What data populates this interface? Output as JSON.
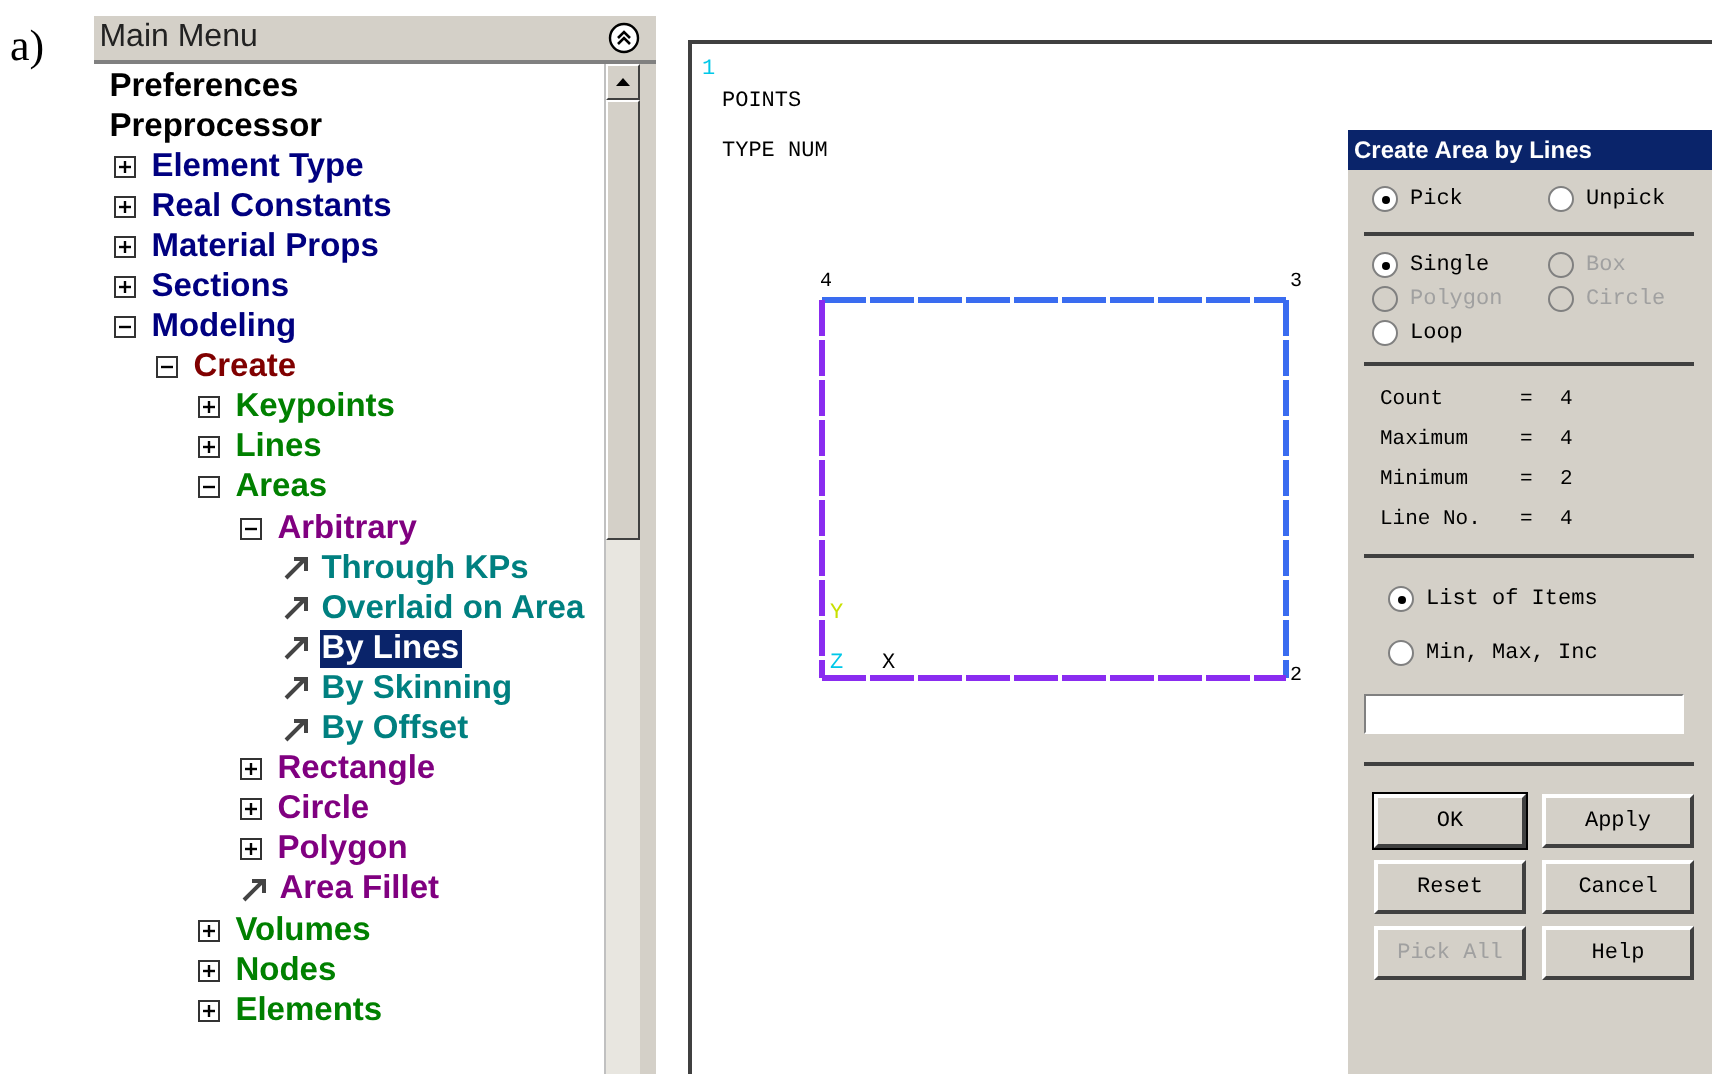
{
  "figure_label": "a)",
  "menu": {
    "title": "Main Menu",
    "items": [
      {
        "label": "Preferences",
        "selected": false,
        "color": "#000000"
      },
      {
        "label": "Preprocessor",
        "selected": false,
        "color": "#000000",
        "children": [
          {
            "label": "Element Type",
            "kind": "branch",
            "expanded": false,
            "selected": false,
            "color": "#000080"
          },
          {
            "label": "Real Constants",
            "kind": "branch",
            "expanded": false,
            "selected": false,
            "color": "#000080"
          },
          {
            "label": "Material Props",
            "kind": "branch",
            "expanded": false,
            "selected": false,
            "color": "#000080"
          },
          {
            "label": "Sections",
            "kind": "branch",
            "expanded": false,
            "selected": false,
            "color": "#000080"
          },
          {
            "label": "Modeling",
            "kind": "branch",
            "expanded": true,
            "selected": false,
            "color": "#000080",
            "children": [
              {
                "label": "Create",
                "kind": "branch",
                "expanded": true,
                "selected": false,
                "color": "#800000",
                "children": [
                  {
                    "label": "Keypoints",
                    "kind": "branch",
                    "expanded": false,
                    "selected": false,
                    "color": "#008000"
                  },
                  {
                    "label": "Lines",
                    "kind": "branch",
                    "expanded": false,
                    "selected": false,
                    "color": "#008000"
                  },
                  {
                    "label": "Areas",
                    "kind": "branch",
                    "expanded": true,
                    "selected": false,
                    "color": "#008000",
                    "children": [
                      {
                        "label": "Arbitrary",
                        "kind": "branch",
                        "expanded": true,
                        "selected": false,
                        "color": "#800080",
                        "children": [
                          {
                            "label": "Through KPs",
                            "kind": "action",
                            "selected": false,
                            "color": "#008080"
                          },
                          {
                            "label": "Overlaid on Area",
                            "kind": "action",
                            "selected": false,
                            "color": "#008080"
                          },
                          {
                            "label": "By Lines",
                            "kind": "action",
                            "selected": true
                          },
                          {
                            "label": "By Skinning",
                            "kind": "action",
                            "selected": false,
                            "color": "#008080"
                          },
                          {
                            "label": "By Offset",
                            "kind": "action",
                            "selected": false,
                            "color": "#008080"
                          }
                        ]
                      },
                      {
                        "label": "Rectangle",
                        "kind": "branch",
                        "expanded": false,
                        "selected": false,
                        "color": "#800080"
                      },
                      {
                        "label": "Circle",
                        "kind": "branch",
                        "expanded": false,
                        "selected": false,
                        "color": "#800080"
                      },
                      {
                        "label": "Polygon",
                        "kind": "branch",
                        "expanded": false,
                        "selected": false,
                        "color": "#800080"
                      },
                      {
                        "label": "Area Fillet",
                        "kind": "action",
                        "selected": false,
                        "color": "#800080"
                      }
                    ]
                  },
                  {
                    "label": "Volumes",
                    "kind": "branch",
                    "expanded": false,
                    "selected": false,
                    "color": "#008000"
                  },
                  {
                    "label": "Nodes",
                    "kind": "branch",
                    "expanded": false,
                    "selected": false,
                    "color": "#008000"
                  },
                  {
                    "label": "Elements",
                    "kind": "branch",
                    "expanded": false,
                    "selected": false,
                    "color": "#008000"
                  }
                ]
              }
            ]
          }
        ]
      }
    ]
  },
  "graphics": {
    "window_number": "1",
    "legend": [
      "POINTS",
      "TYPE NUM"
    ],
    "keypoints": [
      {
        "label": "4"
      },
      {
        "label": "3"
      },
      {
        "label": "2"
      }
    ],
    "axes": [
      {
        "label": "Y",
        "color": "#c8e000"
      },
      {
        "label": "Z",
        "color": "#00c8e8"
      },
      {
        "label": "X",
        "color": "#000000"
      }
    ]
  },
  "dialog": {
    "title": "Create Area by Lines",
    "pick_mode": [
      {
        "label": "Pick",
        "selected": true
      },
      {
        "label": "Unpick",
        "selected": false
      }
    ],
    "pick_type": [
      {
        "label": "Single",
        "selected": true,
        "disabled": false
      },
      {
        "label": "Box",
        "selected": false,
        "disabled": true
      },
      {
        "label": "Polygon",
        "selected": false,
        "disabled": true
      },
      {
        "label": "Circle",
        "selected": false,
        "disabled": true
      },
      {
        "label": "Loop",
        "selected": false,
        "disabled": false
      }
    ],
    "stats": [
      {
        "label": "Count",
        "equals": "=",
        "value": "4"
      },
      {
        "label": "Maximum",
        "equals": "=",
        "value": "4"
      },
      {
        "label": "Minimum",
        "equals": "=",
        "value": "2"
      },
      {
        "label": "Line No.",
        "equals": "=",
        "value": "4"
      }
    ],
    "list_mode": [
      {
        "label": "List of Items",
        "selected": true
      },
      {
        "label": "Min, Max, Inc",
        "selected": false
      }
    ],
    "buttons": [
      {
        "label": "OK",
        "disabled": false
      },
      {
        "label": "Apply",
        "disabled": false
      },
      {
        "label": "Reset",
        "disabled": false
      },
      {
        "label": "Cancel",
        "disabled": false
      },
      {
        "label": "Pick All",
        "disabled": true
      },
      {
        "label": "Help",
        "disabled": false
      }
    ]
  }
}
